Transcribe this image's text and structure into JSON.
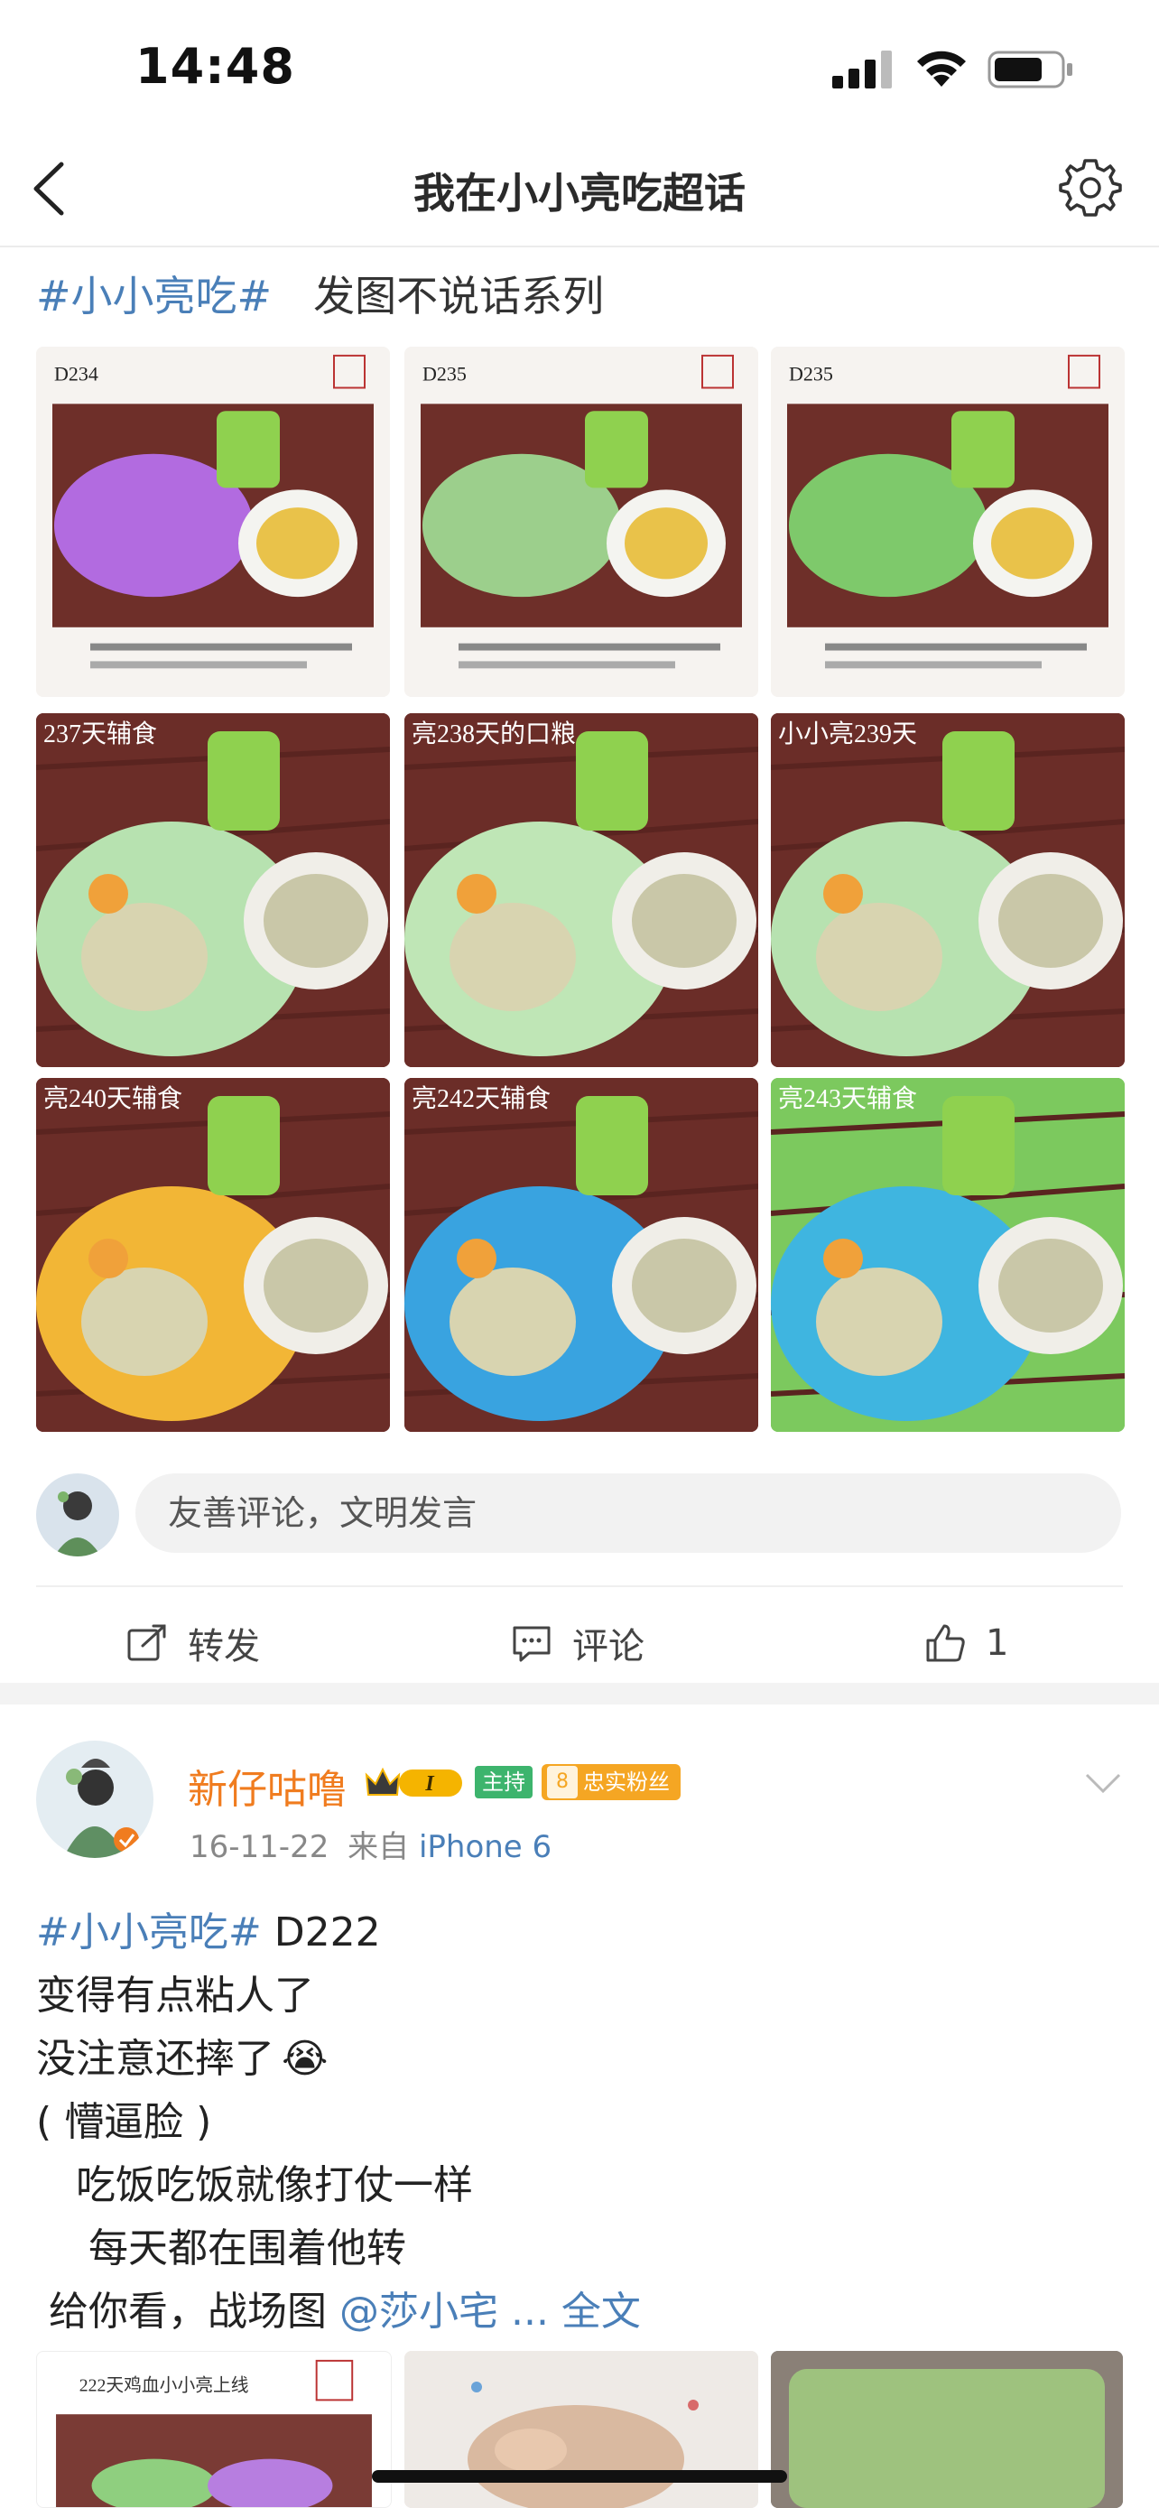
{
  "status_bar": {
    "time": "14:48"
  },
  "nav": {
    "title": "我在小小亮吃超话"
  },
  "post1": {
    "topic": "#小小亮吃#",
    "text": "　发图不说话系列",
    "images": [
      {
        "label": "D234"
      },
      {
        "label": "D235"
      },
      {
        "label": "D235"
      },
      {
        "label": "237天辅食"
      },
      {
        "label": "亮238天的口粮"
      },
      {
        "label": "小小亮239天"
      },
      {
        "label": "亮240天辅食"
      },
      {
        "label": "亮242天辅食"
      },
      {
        "label": "亮243天辅食"
      }
    ],
    "comment_placeholder": "友善评论，文明发言",
    "actions": {
      "repost": "转发",
      "comment": "评论",
      "like_count": "1"
    }
  },
  "post2": {
    "username": "新仔咕噜",
    "level_badge": "I",
    "host_badge": "主持",
    "fan_badge_level": "8",
    "fan_badge": "忠实粉丝",
    "date": "16-11-22",
    "source_prefix": "来自",
    "source": "iPhone 6",
    "topic": "#小小亮吃#",
    "line1_rest": " D222",
    "line2": "变得有点粘人了",
    "line3": "没注意还摔了",
    "line3_emoji": "😭",
    "line4": "( 懵逼脸 )",
    "line5": "　吃饭吃饭就像打仗一样",
    "line6": "　 每天都在围着他转",
    "line7": " 给你看，战场图 ",
    "mention": "@莎小宅",
    "more": " ... 全文",
    "preview_label": "222天鸡血小小亮上线"
  },
  "colors": {
    "topic": "#4a7fb8",
    "username": "#f07c1f",
    "host_badge": "#3db46d",
    "fan_badge": "#f5a623"
  }
}
